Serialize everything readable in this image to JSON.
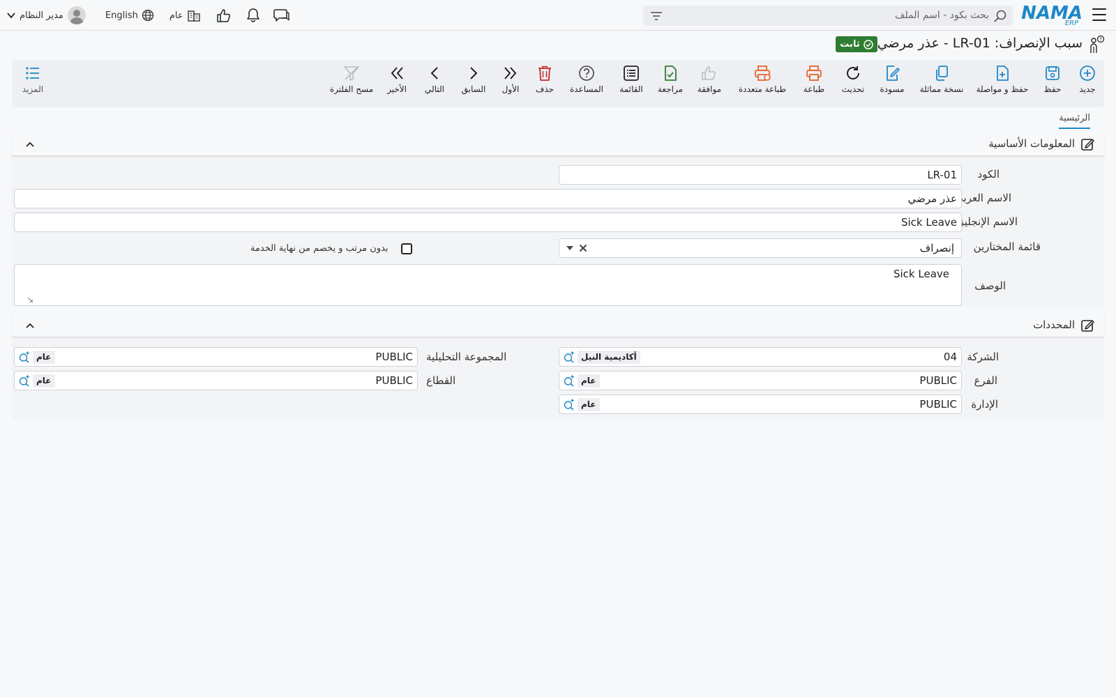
{
  "header": {
    "logo_text": "NAMA",
    "logo_sub": "ERP",
    "search_placeholder": "بحث بكود - اسم الملف",
    "user_name": "مدير النظام",
    "language": "English",
    "branch": "عام"
  },
  "title": {
    "text": "سبب الإنصراف: LR-01 - عذر مرضي",
    "status": "ثابت"
  },
  "toolbar": {
    "new": "جديد",
    "save": "حفظ",
    "save_continue": "حفظ و مواصلة",
    "duplicate": "نسخة مماثلة",
    "draft": "مسودة",
    "refresh": "تحديث",
    "print": "طباعة",
    "multi_print": "طباعة متعددة",
    "approve": "موافقة",
    "review": "مراجعة",
    "list": "القائمة",
    "help": "المساعدة",
    "delete": "حذف",
    "first": "الأول",
    "previous": "السابق",
    "next": "التالي",
    "last": "الأخير",
    "clear_filter": "مسح الفلترة",
    "more": "المزيد"
  },
  "tabs": {
    "main": "الرئيسية"
  },
  "basic": {
    "title": "المعلومات الأساسية",
    "code_label": "الكود",
    "code_value": "LR-01",
    "arabic_name_label": "الاسم العربي",
    "arabic_name_value": "عذر مرضي",
    "english_name_label": "الاسم الإنجليزي",
    "english_name_value": "Sick Leave",
    "chooser_label": "قائمة المختارين",
    "chooser_value": "إنصراف",
    "no_salary_label": "بدون مرتب و يخصم من نهاية الخدمة",
    "no_salary_checked": false,
    "description_label": "الوصف",
    "description_value": "Sick Leave"
  },
  "dimensions": {
    "title": "المحددات",
    "company_label": "الشركة",
    "company_code": "04",
    "company_name": "أكاديمية النيل",
    "branch_label": "الفرع",
    "branch_code": "PUBLIC",
    "branch_name": "عام",
    "department_label": "الإدارة",
    "department_code": "PUBLIC",
    "department_name": "عام",
    "analysis_label": "المجموعة التحليلية",
    "analysis_code": "PUBLIC",
    "analysis_name": "عام",
    "sector_label": "القطاع",
    "sector_code": "PUBLIC",
    "sector_name": "عام"
  }
}
